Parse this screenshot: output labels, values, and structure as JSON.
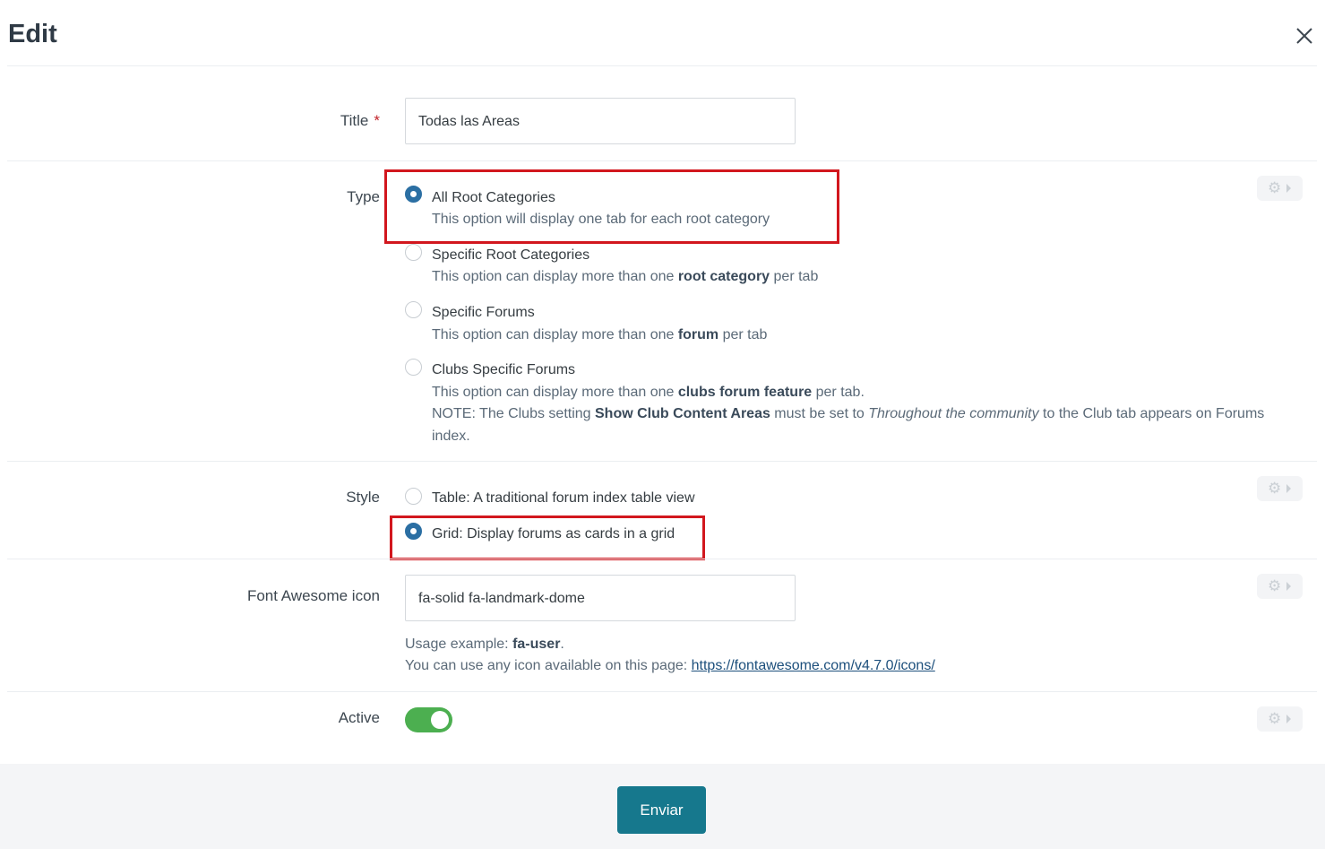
{
  "dialog": {
    "title": "Edit",
    "close_icon": "close-icon"
  },
  "title_field": {
    "label": "Title",
    "required_mark": "*",
    "value": "Todas las Areas"
  },
  "type_field": {
    "label": "Type",
    "options": [
      {
        "label": "All Root Categories",
        "selected": true,
        "desc": "This option will display one tab for each root category"
      },
      {
        "label": "Specific Root Categories",
        "selected": false,
        "desc_pre": "This option can display more than one ",
        "desc_bold": "root category",
        "desc_post": " per tab"
      },
      {
        "label": "Specific Forums",
        "selected": false,
        "desc_pre": "This option can display more than one ",
        "desc_bold": "forum",
        "desc_post": " per tab"
      },
      {
        "label": "Clubs Specific Forums",
        "selected": false,
        "desc_pre": "This option can display more than one ",
        "desc_bold": "clubs forum feature",
        "desc_post": " per tab.",
        "note_pre": "NOTE: The Clubs setting ",
        "note_bold": "Show Club Content Areas",
        "note_mid": " must be set to ",
        "note_italic": "Throughout the community",
        "note_post": " to the Club tab appears on Forums",
        "note_wrap": "index."
      }
    ]
  },
  "style_field": {
    "label": "Style",
    "options": [
      {
        "label": "Table: A traditional forum index table view",
        "selected": false
      },
      {
        "label": "Grid: Display forums as cards in a grid",
        "selected": true
      }
    ]
  },
  "icon_field": {
    "label": "Font Awesome icon",
    "value": "fa-solid fa-landmark-dome",
    "help_pre": "Usage example: ",
    "help_bold": "fa-user",
    "help_post": ".",
    "help2_pre": "You can use any icon available on this page: ",
    "help2_link": "https://fontawesome.com/v4.7.0/icons/"
  },
  "active_field": {
    "label": "Active",
    "on": true
  },
  "footer": {
    "submit_label": "Enviar"
  },
  "colors": {
    "accent": "#2b6fa3",
    "button": "#16788d",
    "toggle_on": "#4caf50",
    "highlight": "#d2171e"
  },
  "icons": {
    "settings": "gear-icon",
    "arrow": "caret-right-icon"
  }
}
